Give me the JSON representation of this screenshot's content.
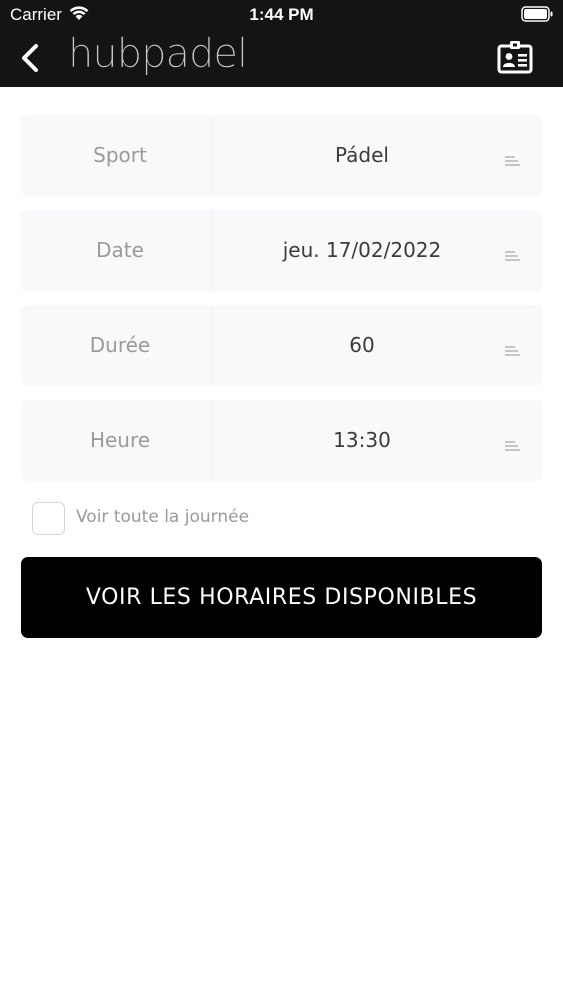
{
  "status_bar": {
    "carrier": "Carrier",
    "time": "1:44 PM"
  },
  "nav": {
    "logo_text": "hubpadel",
    "icons": [
      "back-chevron-icon",
      "id-card-icon"
    ]
  },
  "form": {
    "rows": [
      {
        "label": "Sport",
        "value": "Pádel"
      },
      {
        "label": "Date",
        "value": "jeu. 17/02/2022"
      },
      {
        "label": "Durée",
        "value": "60"
      },
      {
        "label": "Heure",
        "value": "13:30"
      }
    ],
    "checkbox": {
      "label": "Voir toute la journée",
      "checked": false
    },
    "submit_label": "VOIR LES HORAIRES DISPONIBLES"
  },
  "colors": {
    "navbar_bg": "#141414",
    "row_bg": "#f9f8fb",
    "button_bg": "#000000",
    "label_text": "#9a9a9a",
    "value_text": "#3b3b3b"
  }
}
